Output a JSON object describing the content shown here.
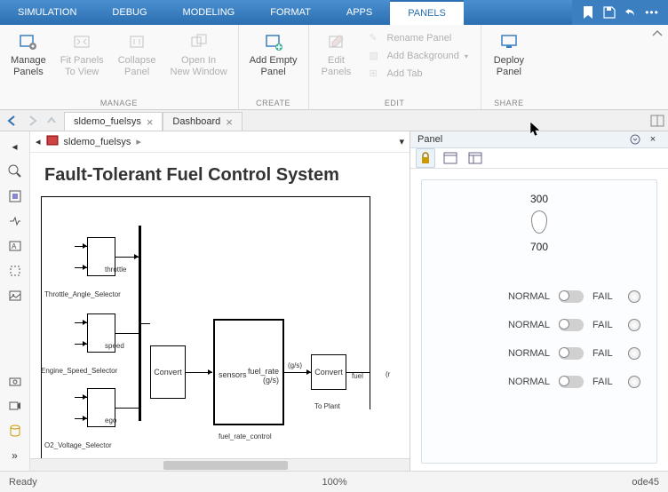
{
  "menubar": {
    "tabs": [
      "SIMULATION",
      "DEBUG",
      "MODELING",
      "FORMAT",
      "APPS",
      "PANELS"
    ],
    "active": 5
  },
  "ribbon": {
    "manage": {
      "label": "MANAGE",
      "manage_panels": "Manage\nPanels",
      "fit_panels": "Fit Panels\nTo View",
      "collapse_panel": "Collapse\nPanel",
      "open_in": "Open In\nNew Window"
    },
    "create": {
      "label": "CREATE",
      "add_empty": "Add Empty\nPanel"
    },
    "edit": {
      "label": "EDIT",
      "edit_panels": "Edit\nPanels",
      "rename": "Rename Panel",
      "add_bg": "Add Background",
      "add_tab": "Add Tab"
    },
    "share": {
      "label": "SHARE",
      "deploy": "Deploy\nPanel"
    }
  },
  "doc_tabs": {
    "tab1": "sldemo_fuelsys",
    "tab2": "Dashboard"
  },
  "breadcrumb": {
    "model": "sldemo_fuelsys"
  },
  "canvas": {
    "title": "Fault-Tolerant Fuel Control System",
    "blocks": {
      "throttle": "throttle",
      "throttle_sel": "Throttle_Angle_Selector",
      "speed": "speed",
      "speed_sel": "Engine_Speed_Selector",
      "ego": "ego",
      "o2_sel": "O2_Voltage_Selector",
      "convert1": "Convert",
      "sensors": "sensors",
      "fuel_rate": "fuel_rate",
      "fuel_rate_unit": "(g/s)",
      "fuel_rate_control": "fuel_rate_control",
      "convert2": "Convert",
      "fuel": "fuel",
      "to_plant": "To Plant",
      "gs": "(g/s)",
      "r_trunc": "(r"
    }
  },
  "panel": {
    "title": "Panel",
    "gauge_top": "300",
    "gauge_bottom": "700",
    "toggles": [
      {
        "left": "NORMAL",
        "right": "FAIL"
      },
      {
        "left": "NORMAL",
        "right": "FAIL"
      },
      {
        "left": "NORMAL",
        "right": "FAIL"
      },
      {
        "left": "NORMAL",
        "right": "FAIL"
      }
    ]
  },
  "status": {
    "ready": "Ready",
    "zoom": "100%",
    "solver": "ode45"
  }
}
